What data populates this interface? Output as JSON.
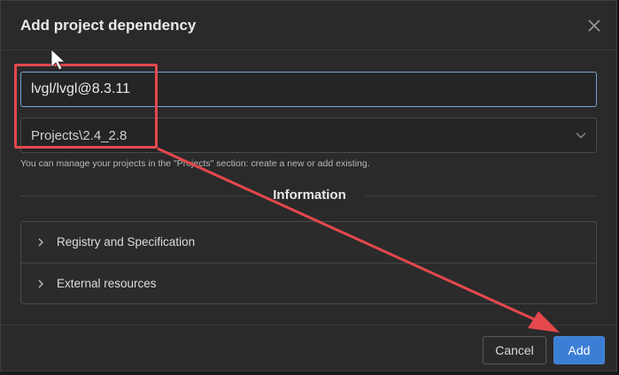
{
  "dialog": {
    "title": "Add project dependency",
    "close_icon": "close-icon"
  },
  "package_input": {
    "value": "lvgl/lvgl@8.3.11"
  },
  "project_select": {
    "selected": "Projects\\2.4_2.8",
    "chevron_icon": "chevron-down-icon"
  },
  "hint_text": "You can manage your projects in the \"Projects\" section: create a new or add existing.",
  "information": {
    "heading": "Information",
    "items": [
      {
        "label": "Registry and Specification",
        "icon": "chevron-right-icon"
      },
      {
        "label": "External resources",
        "icon": "chevron-right-icon"
      }
    ]
  },
  "footer": {
    "cancel_label": "Cancel",
    "add_label": "Add"
  },
  "colors": {
    "accent": "#3b7fd4",
    "annotation": "#e5484d"
  }
}
